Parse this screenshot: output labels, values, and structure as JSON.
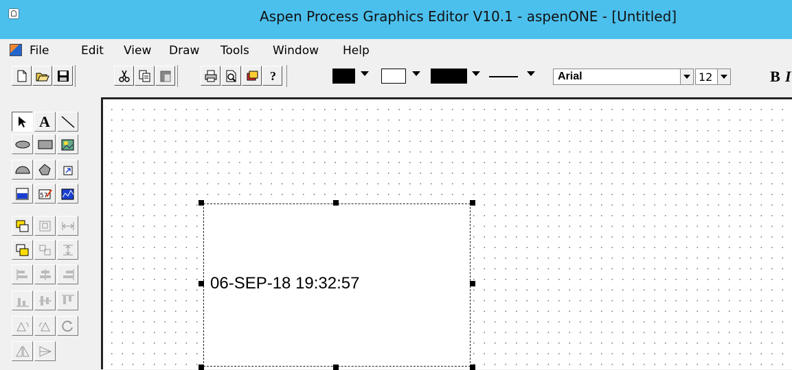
{
  "window": {
    "title": "Aspen Process Graphics Editor V10.1 - aspenONE - [Untitled]"
  },
  "menu": {
    "items": [
      "File",
      "Edit",
      "View",
      "Draw",
      "Tools",
      "Window",
      "Help"
    ]
  },
  "toolbar": {
    "font_name": "Arial",
    "font_size": "12",
    "bold_label": "B",
    "italic_label": "I"
  },
  "canvas": {
    "selected_text": "06-SEP-18 19:32:57"
  },
  "palette": {
    "text_tool_label": "A"
  },
  "colors": {
    "titlebar": "#4cc0ed",
    "canvas": "#ffffff",
    "grid_dots": "#7a7a7a"
  }
}
